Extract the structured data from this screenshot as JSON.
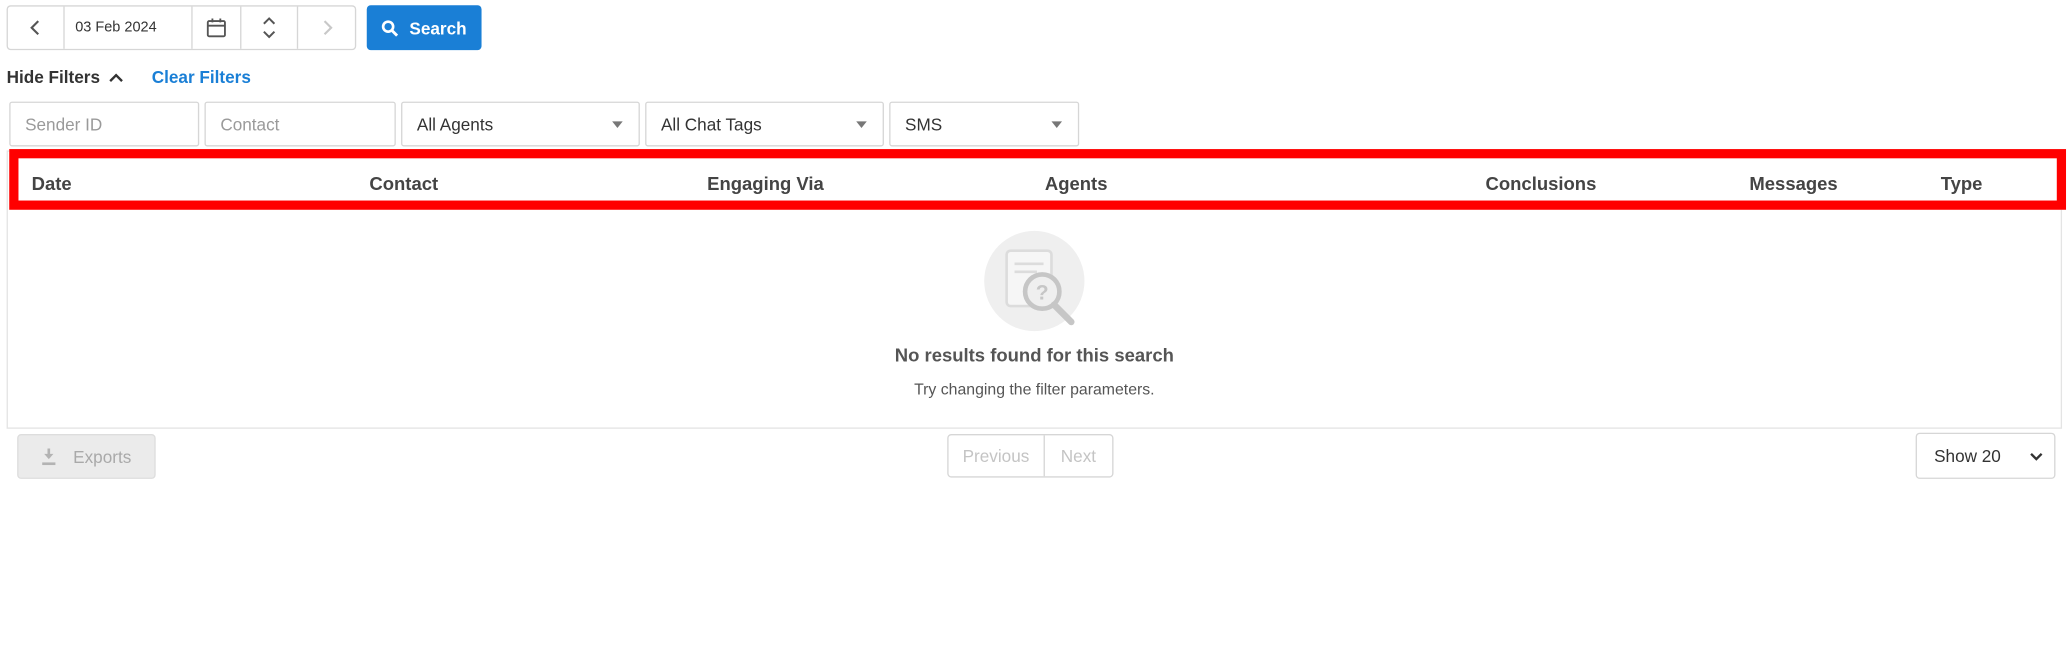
{
  "toolbar": {
    "date_value": "03 Feb 2024",
    "search_label": "Search"
  },
  "filters": {
    "hide_label": "Hide Filters",
    "clear_label": "Clear Filters",
    "sender_id_placeholder": "Sender ID",
    "contact_placeholder": "Contact",
    "agents_value": "All Agents",
    "chat_tags_value": "All Chat Tags",
    "channel_value": "SMS"
  },
  "table": {
    "columns": [
      "Date",
      "Contact",
      "Engaging Via",
      "Agents",
      "Conclusions",
      "Messages",
      "Type"
    ],
    "empty_title": "No results found for this search",
    "empty_subtitle": "Try changing the filter parameters."
  },
  "footer": {
    "exports_label": "Exports",
    "previous_label": "Previous",
    "next_label": "Next",
    "show_value": "Show 20"
  },
  "colors": {
    "accent": "#1a7fd6",
    "highlight": "#ff0000"
  },
  "icons": {
    "prev": "chevron-left-icon",
    "calendar": "calendar-icon",
    "spinner": "up-down-icon",
    "next": "chevron-right-icon",
    "search": "search-icon",
    "collapse": "chevron-up-icon",
    "dropdown": "caret-down-icon",
    "empty": "no-results-icon",
    "download": "download-icon"
  }
}
